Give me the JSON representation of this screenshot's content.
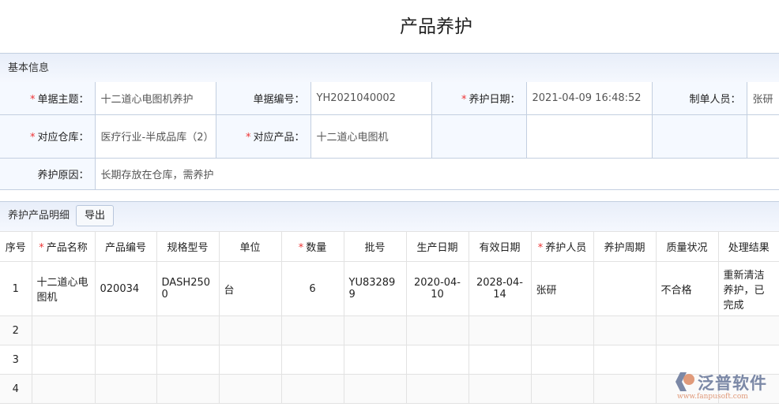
{
  "title": "产品养护",
  "basic": {
    "header": "基本信息",
    "subject_label": "单据主题：",
    "subject": "十二道心电图机养护",
    "number_label": "单据编号：",
    "number": "YH2021040002",
    "date_label": "养护日期：",
    "date": "2021-04-09 16:48:52",
    "creator_label": "制单人员：",
    "creator": "张研",
    "warehouse_label": "对应仓库：",
    "warehouse": "医疗行业-半成品库（2）",
    "product_label": "对应产品：",
    "product": "十二道心电图机",
    "reason_label": "养护原因：",
    "reason": "长期存放在仓库，需养护"
  },
  "detail": {
    "header": "养护产品明细",
    "export_label": "导出",
    "columns": [
      "序号",
      "产品名称",
      "产品编号",
      "规格型号",
      "单位",
      "数量",
      "批号",
      "生产日期",
      "有效日期",
      "养护人员",
      "养护周期",
      "质量状况",
      "处理结果"
    ],
    "rows": [
      {
        "no": "1",
        "name": "十二道心电图机",
        "code": "020034",
        "spec": "DASH2500",
        "unit": "台",
        "qty": "6",
        "batch": "YU832899",
        "mfg": "2020-04-10",
        "exp": "2028-04-14",
        "staff": "张研",
        "cycle": "",
        "quality": "不合格",
        "result": "重新清洁养护，已完成"
      }
    ],
    "empty_rows": [
      "2",
      "3",
      "4"
    ]
  },
  "watermark": {
    "brand": "泛普软件",
    "url": "www.fanpusoft.com"
  }
}
